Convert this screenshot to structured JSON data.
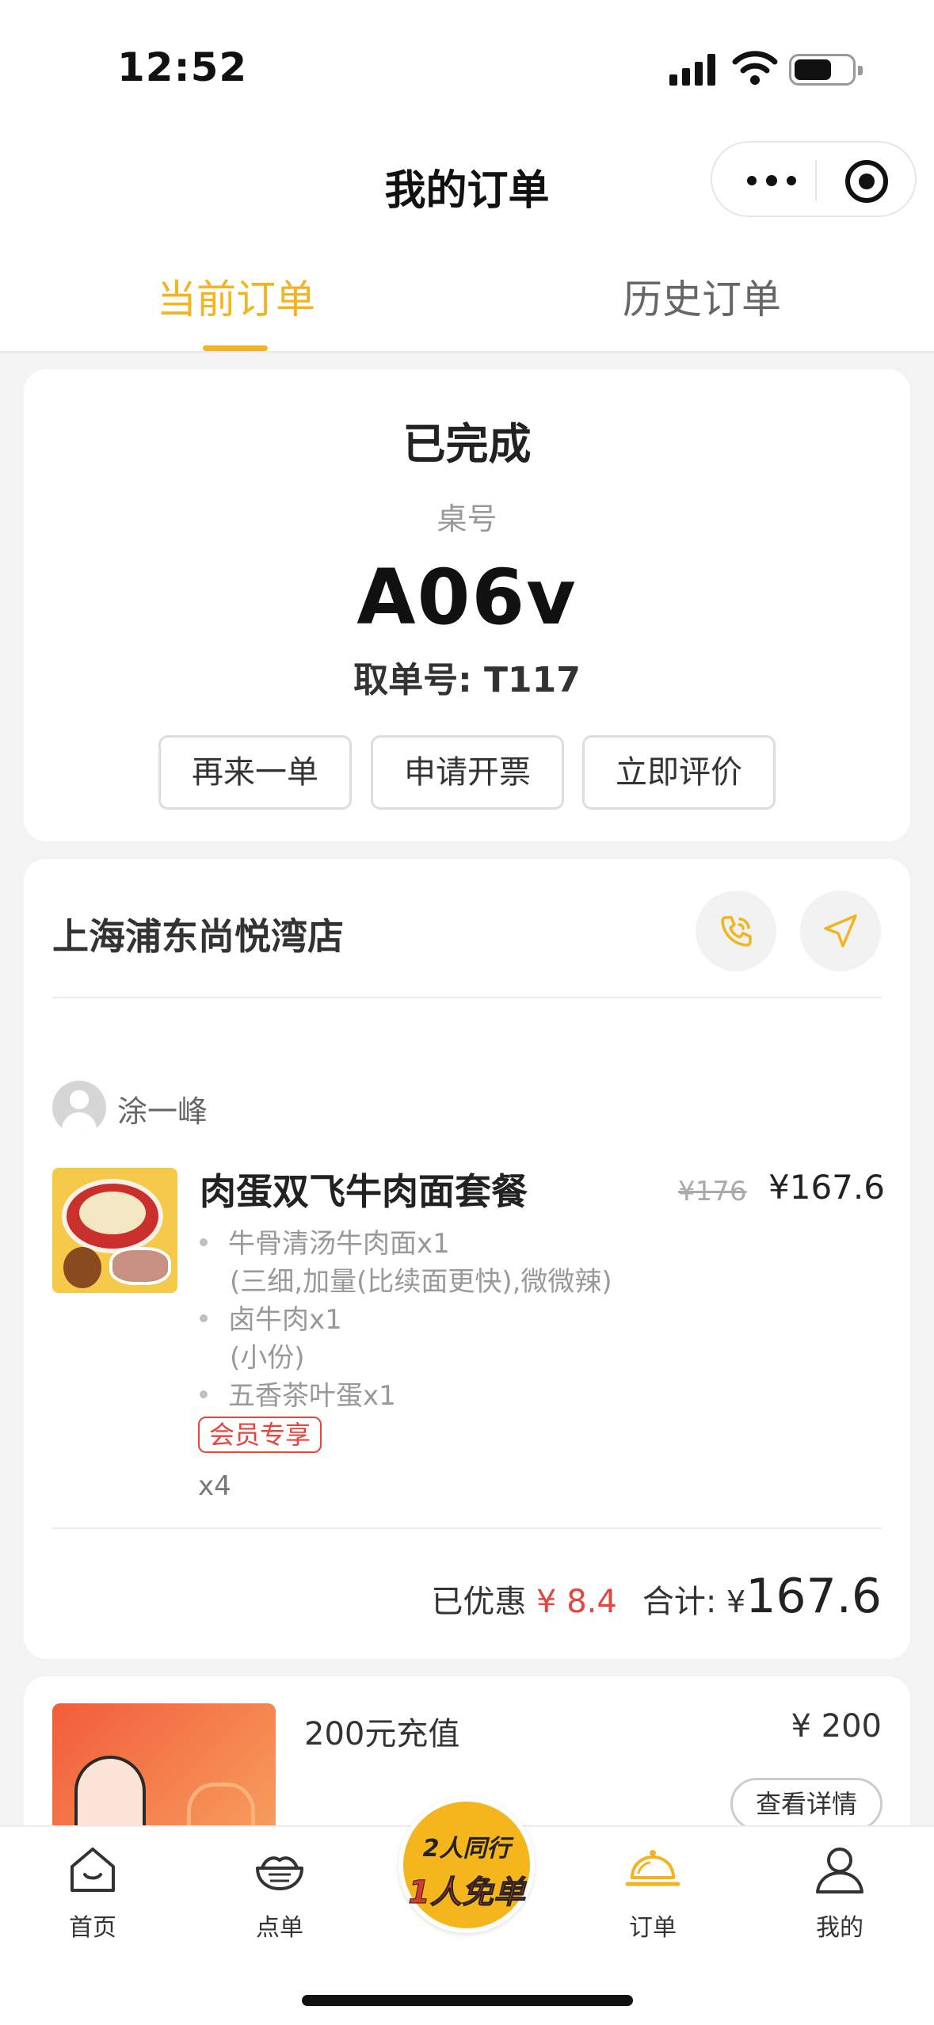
{
  "status_bar": {
    "time": "12:52"
  },
  "nav": {
    "title": "我的订单",
    "more_icon": "more-dots-icon",
    "target_icon": "target-icon"
  },
  "tabs": [
    {
      "label": "当前订单",
      "active": true
    },
    {
      "label": "历史订单",
      "active": false
    }
  ],
  "order_status": {
    "status": "已完成",
    "table_label": "桌号",
    "table_no": "A06v",
    "pickup_label": "取单号: T117",
    "buttons": [
      "再来一单",
      "申请开票",
      "立即评价"
    ]
  },
  "store": {
    "name": "上海浦东尚悦湾店",
    "phone_icon": "phone-icon",
    "navigate_icon": "navigation-arrow-icon"
  },
  "customer": {
    "name": "涂一峰"
  },
  "item": {
    "name": "肉蛋双飞牛肉面套餐",
    "original_price": "¥176",
    "price": "¥167.6",
    "components": [
      {
        "name": "牛骨清汤牛肉面x1",
        "note": "(三细,加量(比续面更快),微微辣)"
      },
      {
        "name": "卤牛肉x1",
        "note": "(小份)"
      },
      {
        "name": "五香茶叶蛋x1",
        "note": ""
      }
    ],
    "tag": "会员专享",
    "quantity": "x4"
  },
  "summary": {
    "discount_label": "已优惠",
    "discount_value": "¥ 8.4",
    "total_label": "合计:",
    "yen": "¥",
    "total_value": "167.6"
  },
  "promo_order": {
    "name": "200元充值",
    "price": "¥ 200",
    "detail_button": "查看详情"
  },
  "tabbar": {
    "items": [
      {
        "label": "首页",
        "icon": "home-icon"
      },
      {
        "label": "点单",
        "icon": "noodle-bowl-icon"
      },
      {
        "label": "订单",
        "icon": "order-cloche-icon",
        "active": true
      },
      {
        "label": "我的",
        "icon": "person-icon"
      }
    ],
    "badge_line1": "2人同行",
    "badge_line2": "1人免单"
  },
  "colors": {
    "accent": "#f2b420",
    "discount": "#e5453e",
    "background": "#f3f3f3"
  }
}
